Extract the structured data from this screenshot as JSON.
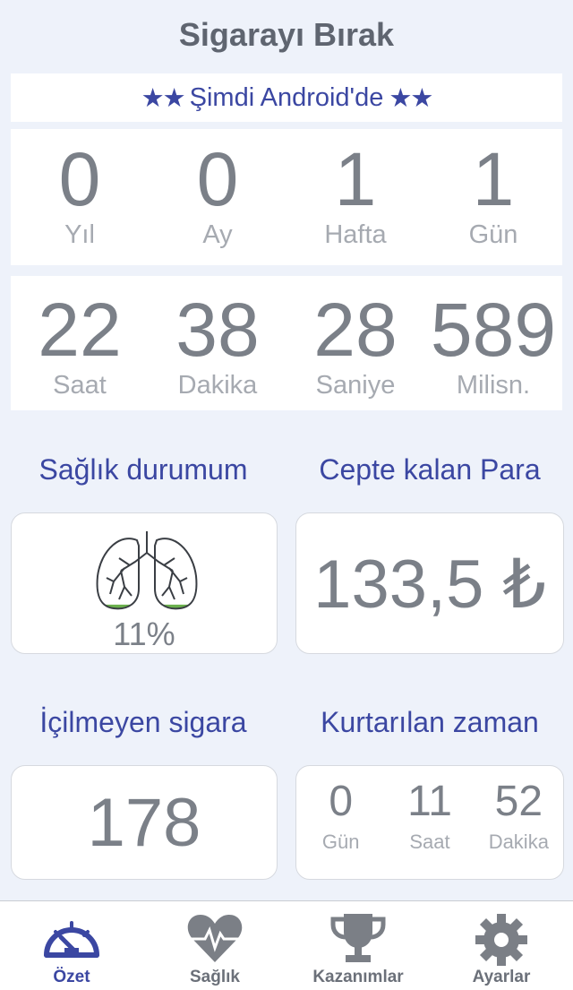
{
  "app": {
    "title": "Sigarayı Bırak"
  },
  "banner": {
    "stars_left": "★★",
    "text": "Şimdi Android'de",
    "stars_right": "★★"
  },
  "counter": {
    "row1": [
      {
        "value": "0",
        "label": "Yıl"
      },
      {
        "value": "0",
        "label": "Ay"
      },
      {
        "value": "1",
        "label": "Hafta"
      },
      {
        "value": "1",
        "label": "Gün"
      }
    ],
    "row2": [
      {
        "value": "22",
        "label": "Saat"
      },
      {
        "value": "38",
        "label": "Dakika"
      },
      {
        "value": "28",
        "label": "Saniye"
      },
      {
        "value": "589",
        "label": "Milisn."
      }
    ]
  },
  "health": {
    "title": "Sağlık durumum",
    "percent": "11%",
    "progress_fraction": 0.11
  },
  "money": {
    "title": "Cepte kalan Para",
    "value": "133,5 ₺"
  },
  "cigarettes": {
    "title": "İçilmeyen sigara",
    "value": "178"
  },
  "time_saved": {
    "title": "Kurtarılan zaman",
    "items": [
      {
        "value": "0",
        "unit": "Gün"
      },
      {
        "value": "11",
        "unit": "Saat"
      },
      {
        "value": "52",
        "unit": "Dakika"
      }
    ]
  },
  "tabs": [
    {
      "label": "Özet",
      "icon": "speedometer-icon",
      "active": true
    },
    {
      "label": "Sağlık",
      "icon": "heart-pulse-icon",
      "active": false
    },
    {
      "label": "Kazanımlar",
      "icon": "trophy-icon",
      "active": false
    },
    {
      "label": "Ayarlar",
      "icon": "gear-icon",
      "active": false
    }
  ],
  "colors": {
    "accent": "#3b47a2",
    "background": "#eef2fa",
    "value_text": "#7b8088",
    "lung_progress": "#6ab04c"
  }
}
